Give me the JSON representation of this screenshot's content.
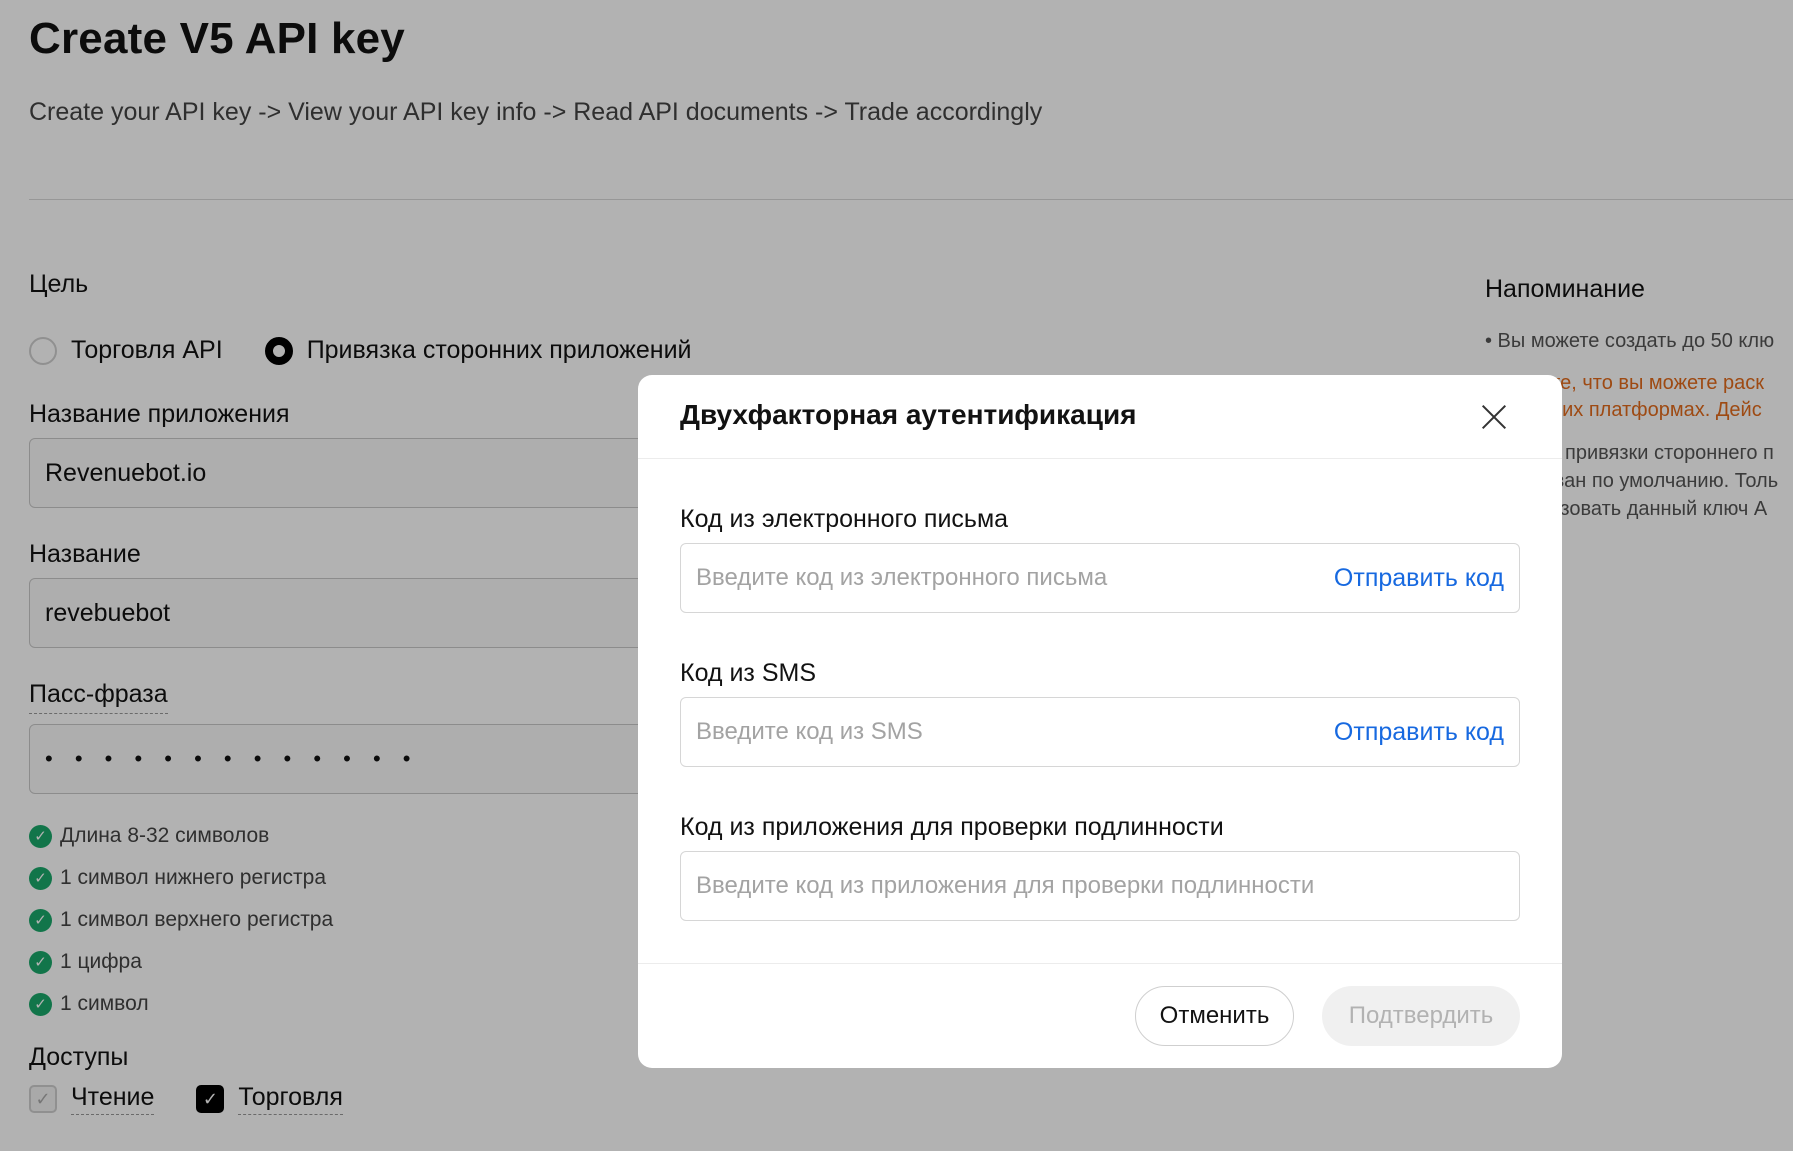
{
  "page": {
    "title": "Create V5 API key",
    "subtitle": "Create your API key -> View your API key info -> Read API documents -> Trade accordingly"
  },
  "form": {
    "purpose_label": "Цель",
    "purpose_options": [
      {
        "label": "Торговля API",
        "checked": false
      },
      {
        "label": "Привязка сторонних приложений",
        "checked": true
      }
    ],
    "app_name_label": "Название приложения",
    "app_name_value": "Revenuebot.io",
    "name_label": "Название",
    "name_value": "revebuebot",
    "passphrase_label": "Пасс-фраза",
    "passphrase_value": "• • • • • • • • • • • • •",
    "password_rules": [
      "Длина 8-32 символов",
      "1 символ нижнего регистра",
      "1 символ верхнего регистра",
      "1 цифра",
      "1 символ"
    ],
    "permissions_label": "Доступы",
    "permissions": [
      {
        "label": "Чтение",
        "checked": true,
        "disabled": true
      },
      {
        "label": "Торговля",
        "checked": true,
        "disabled": false
      }
    ]
  },
  "reminder": {
    "title": "Напоминание",
    "lines": [
      "• Вы можете создать до 50 клю",
      "ите, что вы можете раск",
      "нних платформах. Дейс",
      "привязки стороннего п",
      "зан по умолчанию. Толь",
      "ьзовать данный ключ A"
    ]
  },
  "modal": {
    "title": "Двухфакторная аутентификация",
    "email_label": "Код из электронного письма",
    "email_placeholder": "Введите код из электронного письма",
    "email_send": "Отправить код",
    "sms_label": "Код из SMS",
    "sms_placeholder": "Введите код из SMS",
    "sms_send": "Отправить код",
    "auth_label": "Код из приложения для проверки подлинности",
    "auth_placeholder": "Введите код из приложения для проверки подлинности",
    "cancel": "Отменить",
    "confirm": "Подтвердить"
  },
  "colors": {
    "accent_link": "#1769e0",
    "success": "#1aa86a",
    "warning_text": "#e26b1c",
    "overlay": "rgba(0,0,0,0.30)"
  }
}
